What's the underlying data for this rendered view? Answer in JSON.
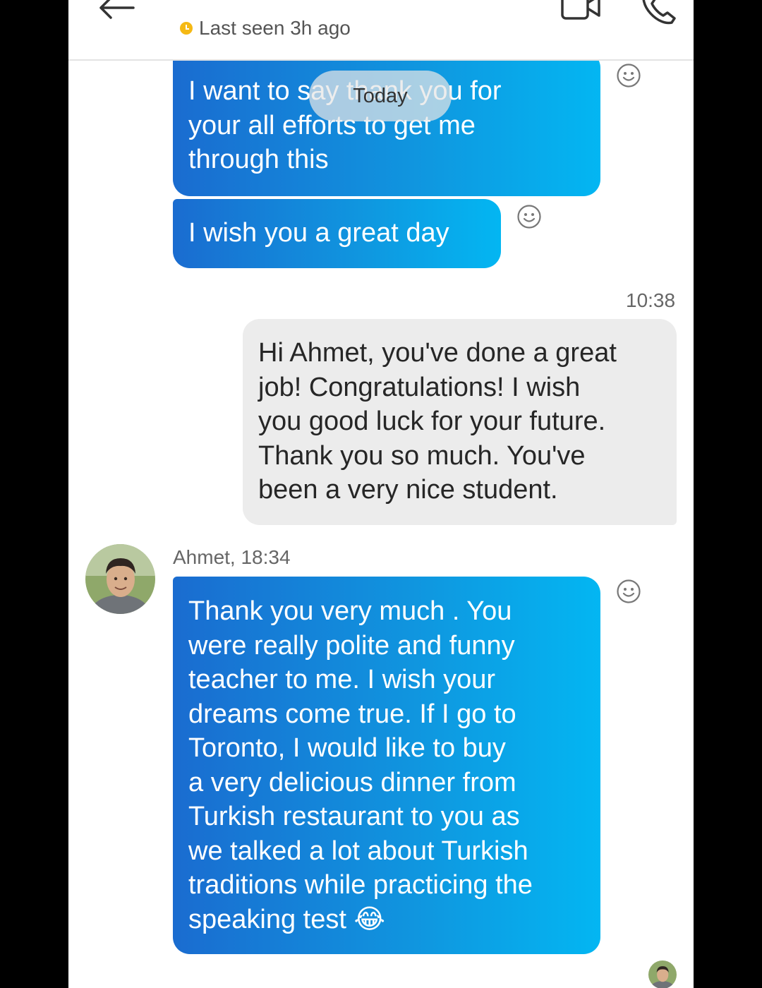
{
  "header": {
    "status_text": "Last seen 3h ago",
    "status_color": "#f5b914",
    "icons": [
      "back-arrow-icon",
      "video-call-icon",
      "phone-call-icon"
    ]
  },
  "date_divider": "Today",
  "messages": [
    {
      "type": "incoming",
      "text": "I want to say thank you for\nyour all efforts to get me\nthrough this"
    },
    {
      "type": "incoming",
      "text": "I wish you a great day"
    },
    {
      "type": "outgoing",
      "time": "10:38",
      "text": "Hi Ahmet, you've done a great\njob! Congratulations! I wish\nyou good luck for your future.\nThank you so much. You've\nbeen a very nice student."
    },
    {
      "type": "incoming",
      "sender": "Ahmet, 18:34",
      "text": "Thank you very much . You\nwere really polite and funny\nteacher to me. I wish your\ndreams come true. If I go to\nToronto, I would like to buy\na very delicious dinner from\nTurkish restaurant to you as\nwe talked a lot about Turkish\ntraditions while practicing the\nspeaking test",
      "emoji": "😂"
    }
  ],
  "colors": {
    "incoming_bubble_start": "#1a6cd0",
    "incoming_bubble_end": "#03b6f2",
    "outgoing_bubble": "#ececec"
  }
}
